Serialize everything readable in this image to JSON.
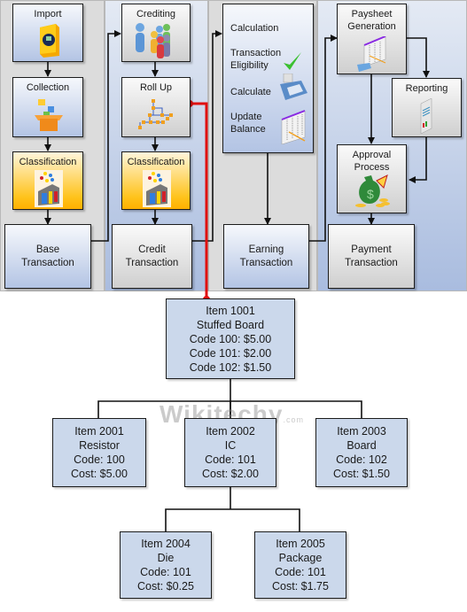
{
  "process_flow": {
    "lanes": [
      {
        "id": "base",
        "steps": [
          "Import",
          "Collection",
          "Classification"
        ],
        "result": "Base Transaction"
      },
      {
        "id": "credit",
        "steps": [
          "Crediting",
          "Roll Up",
          "Classification"
        ],
        "result": "Credit Transaction"
      },
      {
        "id": "earning",
        "calculation": {
          "title": "Calculation",
          "items": [
            "Transaction Eligibility",
            "Calculate",
            "Update Balance"
          ]
        },
        "result": "Earning Transaction"
      },
      {
        "id": "payment",
        "steps": [
          "Paysheet Generation",
          "Reporting",
          "Approval Process"
        ],
        "result": "Payment Transaction"
      }
    ],
    "icons": {
      "import": "software-box-icon",
      "collection": "open-box-icon",
      "classification": "sorting-machine-icon",
      "crediting": "people-group-icon",
      "roll_up": "hierarchy-icon",
      "eligibility": "checkmark-icon",
      "calculate": "calculator-icon",
      "update_balance": "spreadsheet-icon",
      "paysheet": "spreadsheet-icon",
      "reporting": "report-icon",
      "approval": "money-bag-icon"
    },
    "colors": {
      "link_red": "#e01010",
      "lane_blue": "#a9bcdf",
      "lane_gray": "#dcdcdc",
      "classification_orange": "#ffc21a",
      "node_fill": "#cbd8eb"
    }
  },
  "rollup_tree": {
    "root": {
      "lines": [
        "Item 1001",
        "Stuffed Board",
        "Code 100: $5.00",
        "Code 101: $2.00",
        "Code 102: $1.50"
      ]
    },
    "level2": [
      {
        "lines": [
          "Item 2001",
          "Resistor",
          "Code: 100",
          "Cost: $5.00"
        ]
      },
      {
        "lines": [
          "Item 2002",
          "IC",
          "Code: 101",
          "Cost: $2.00"
        ]
      },
      {
        "lines": [
          "Item 2003",
          "Board",
          "Code: 102",
          "Cost: $1.50"
        ]
      }
    ],
    "level3": [
      {
        "lines": [
          "Item 2004",
          "Die",
          "Code: 101",
          "Cost: $0.25"
        ]
      },
      {
        "lines": [
          "Item 2005",
          "Package",
          "Code: 101",
          "Cost: $1.75"
        ]
      }
    ]
  },
  "watermark": {
    "text": "Wikitechy",
    "suffix": ".com"
  }
}
